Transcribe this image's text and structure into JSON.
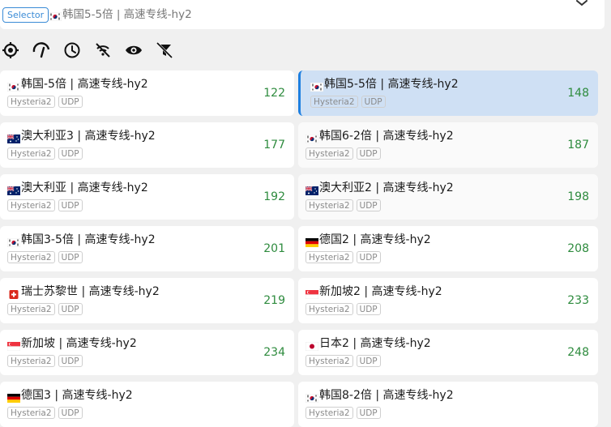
{
  "header": {
    "badge": "Selector",
    "current_flag": "kr",
    "current": "韩国5-5倍 | 高速专线-hy2"
  },
  "toolbar": [
    {
      "name": "locate-icon"
    },
    {
      "name": "speed-test-icon"
    },
    {
      "name": "clock-icon"
    },
    {
      "name": "signal-off-icon"
    },
    {
      "name": "eye-icon"
    },
    {
      "name": "filter-off-icon"
    }
  ],
  "colors": {
    "accent": "#1e7fe0",
    "delay_good": "#2e8b3e",
    "selected_bg": "#cfe0f4"
  },
  "proxies": [
    {
      "flag": "kr",
      "name": "韩国-5倍 | 高速专线-hy2",
      "tags": [
        "Hysteria2",
        "UDP"
      ],
      "delay": "122",
      "state": "normal"
    },
    {
      "flag": "kr",
      "name": "韩国5-5倍 | 高速专线-hy2",
      "tags": [
        "Hysteria2",
        "UDP"
      ],
      "delay": "148",
      "state": "selected"
    },
    {
      "flag": "au",
      "name": "澳大利亚3 | 高速专线-hy2",
      "tags": [
        "Hysteria2",
        "UDP"
      ],
      "delay": "177",
      "state": "normal"
    },
    {
      "flag": "kr",
      "name": "韩国6-2倍 | 高速专线-hy2",
      "tags": [
        "Hysteria2",
        "UDP"
      ],
      "delay": "187",
      "state": "alt"
    },
    {
      "flag": "au",
      "name": "澳大利亚 | 高速专线-hy2",
      "tags": [
        "Hysteria2",
        "UDP"
      ],
      "delay": "192",
      "state": "normal"
    },
    {
      "flag": "au",
      "name": "澳大利亚2 | 高速专线-hy2",
      "tags": [
        "Hysteria2",
        "UDP"
      ],
      "delay": "198",
      "state": "alt"
    },
    {
      "flag": "kr",
      "name": "韩国3-5倍 | 高速专线-hy2",
      "tags": [
        "Hysteria2",
        "UDP"
      ],
      "delay": "201",
      "state": "normal"
    },
    {
      "flag": "de",
      "name": "德国2 | 高速专线-hy2",
      "tags": [
        "Hysteria2",
        "UDP"
      ],
      "delay": "208",
      "state": "normal"
    },
    {
      "flag": "ch",
      "name": "瑞士苏黎世 | 高速专线-hy2",
      "tags": [
        "Hysteria2",
        "UDP"
      ],
      "delay": "219",
      "state": "normal"
    },
    {
      "flag": "sg",
      "name": "新加坡2 | 高速专线-hy2",
      "tags": [
        "Hysteria2",
        "UDP"
      ],
      "delay": "233",
      "state": "normal"
    },
    {
      "flag": "sg",
      "name": "新加坡 | 高速专线-hy2",
      "tags": [
        "Hysteria2",
        "UDP"
      ],
      "delay": "234",
      "state": "normal"
    },
    {
      "flag": "jp",
      "name": "日本2 | 高速专线-hy2",
      "tags": [
        "Hysteria2",
        "UDP"
      ],
      "delay": "248",
      "state": "normal"
    },
    {
      "flag": "de",
      "name": "德国3 | 高速专线-hy2",
      "tags": [
        "Hysteria2",
        "UDP"
      ],
      "delay": "",
      "state": "normal"
    },
    {
      "flag": "kr",
      "name": "韩国8-2倍 | 高速专线-hy2",
      "tags": [
        "Hysteria2",
        "UDP"
      ],
      "delay": "",
      "state": "normal"
    }
  ]
}
